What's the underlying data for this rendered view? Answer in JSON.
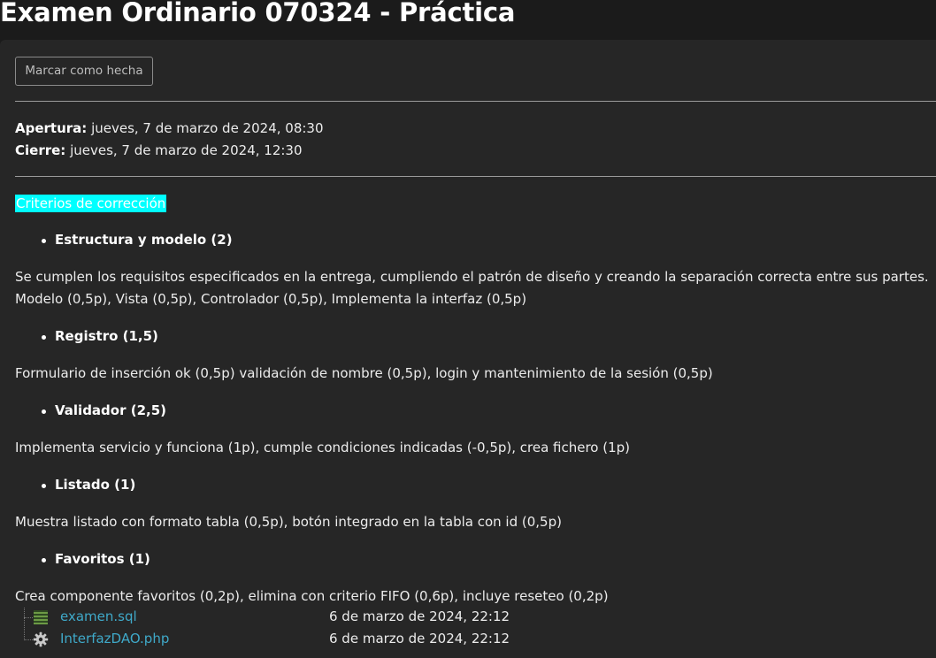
{
  "page_title": "Examen Ordinario 070324 - Práctica",
  "completion_button": "Marcar como hecha",
  "dates": {
    "open_label": "Apertura:",
    "open_value": " jueves, 7 de marzo de 2024, 08:30",
    "close_label": "Cierre:",
    "close_value": " jueves, 7 de marzo de 2024, 12:30"
  },
  "criteria_heading": "Criterios de corrección",
  "colors": {
    "highlight": "#00ffff",
    "link": "#3fa9c9",
    "panel_bg": "#262626",
    "page_bg": "#1b1b1b"
  },
  "criteria": [
    {
      "title": "Estructura y modelo (2)",
      "lines": [
        "Se cumplen los requisitos especificados en la entrega, cumpliendo el patrón de diseño y creando la separación correcta entre sus partes.",
        "Modelo (0,5p), Vista (0,5p), Controlador (0,5p), Implementa la interfaz (0,5p)"
      ]
    },
    {
      "title": "Registro (1,5)",
      "lines": [
        "Formulario de inserción ok (0,5p) validación de nombre (0,5p), login y mantenimiento de la sesión (0,5p)"
      ]
    },
    {
      "title": "Validador (2,5)",
      "lines": [
        "Implementa servicio y funciona (1p), cumple condiciones indicadas (-0,5p), crea fichero (1p)"
      ]
    },
    {
      "title": "Listado (1)",
      "lines": [
        "Muestra listado con formato tabla (0,5p), botón integrado en la tabla con id (0,5p)"
      ]
    },
    {
      "title": "Favoritos (1)",
      "lines": [
        "Crea componente favoritos (0,2p), elimina con criterio FIFO (0,6p), incluye reseteo (0,2p)"
      ]
    }
  ],
  "files": [
    {
      "name": "examen.sql",
      "date": "6 de marzo de 2024, 22:12",
      "icon": "sql-file-icon"
    },
    {
      "name": "InterfazDAO.php",
      "date": "6 de marzo de 2024, 22:12",
      "icon": "gear-file-icon"
    }
  ]
}
